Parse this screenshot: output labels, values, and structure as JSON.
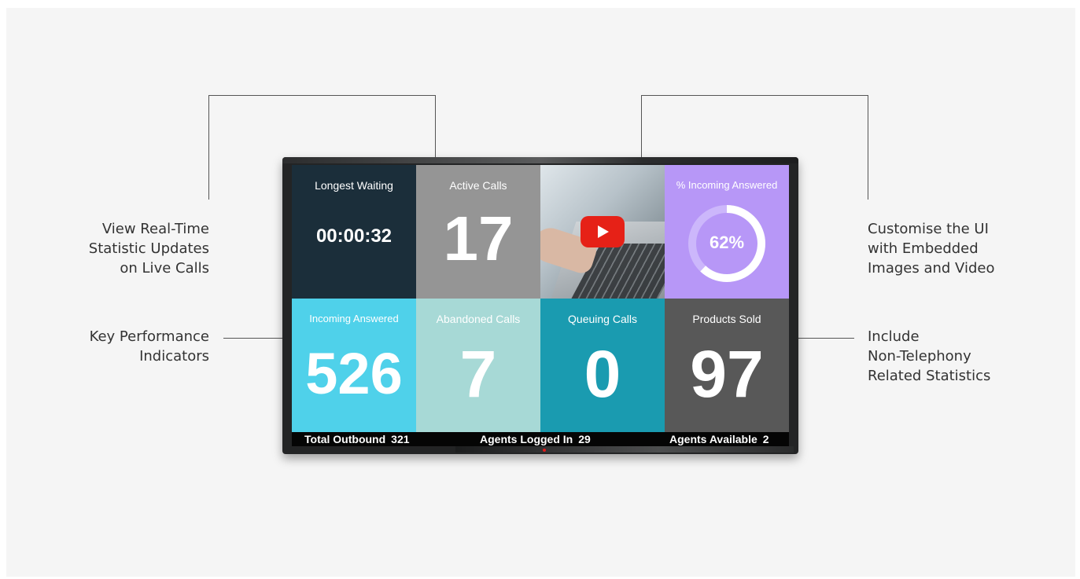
{
  "callouts": {
    "realtime": [
      "View Real-Time",
      "Statistic Updates",
      "on Live Calls"
    ],
    "kpi": [
      "Key Performance",
      "Indicators"
    ],
    "customise": [
      "Customise the UI",
      "with Embedded",
      "Images and Video"
    ],
    "nontelephony": [
      "Include",
      "Non-Telephony",
      "Related Statistics"
    ]
  },
  "tiles": {
    "longest_waiting": {
      "label": "Longest Waiting",
      "value": "00:00:32",
      "color": "#1b2e3a"
    },
    "active_calls": {
      "label": "Active Calls",
      "value": "17",
      "color": "#959595"
    },
    "video": {
      "icon": "play-icon",
      "button_color": "#e62117"
    },
    "incoming_answered_pct": {
      "label": "% Incoming Answered",
      "value": "62%",
      "percent": 62,
      "color": "#b797f7",
      "ring_color": "#ffffff",
      "ring_track": "#ccb7fb"
    },
    "incoming_answered": {
      "label": "Incoming Answered",
      "value": "526",
      "color": "#4fd1ea"
    },
    "abandoned_calls": {
      "label": "Abandoned Calls",
      "value": "7",
      "color": "#a7d9d6"
    },
    "queuing_calls": {
      "label": "Queuing Calls",
      "value": "0",
      "color": "#1a9bb0"
    },
    "products_sold": {
      "label": "Products Sold",
      "value": "97",
      "color": "#585858"
    }
  },
  "status_bar": {
    "total_outbound": {
      "label": "Total Outbound",
      "value": "321"
    },
    "agents_logged_in": {
      "label": "Agents Logged In",
      "value": "29"
    },
    "agents_available": {
      "label": "Agents Available",
      "value": "2"
    }
  }
}
